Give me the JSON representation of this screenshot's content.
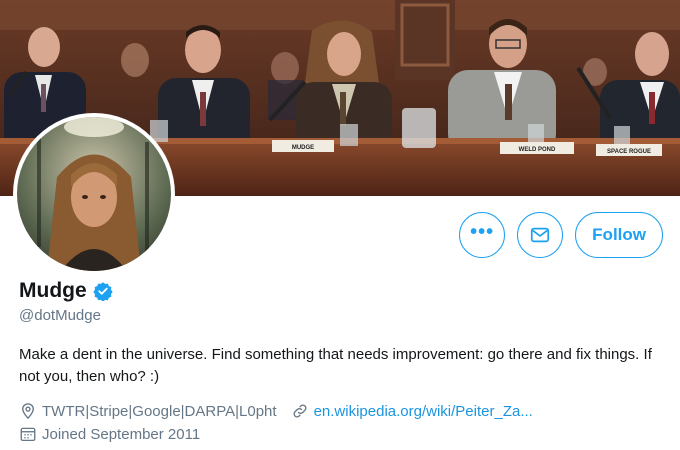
{
  "profile": {
    "display_name": "Mudge",
    "verified_icon": "verified-badge-icon",
    "handle": "@dotMudge",
    "bio": "Make a dent in the universe. Find something that needs improvement: go there and fix things. If not you, then who? :)",
    "location": "TWTR|Stripe|Google|DARPA|L0pht",
    "website": "en.wikipedia.org/wiki/Peiter_Za...",
    "joined": "Joined September 2011"
  },
  "actions": {
    "more_label": "•••",
    "follow_label": "Follow"
  },
  "banner": {
    "nameplates": [
      "MUDGE",
      "WELD POND",
      "SPACE ROGUE"
    ]
  },
  "colors": {
    "accent": "#1da1f2",
    "link": "#1b95e0",
    "secondary_text": "#657786",
    "primary_text": "#14171a"
  },
  "icons": {
    "more": "more-dots-icon",
    "message": "envelope-icon",
    "location": "location-pin-icon",
    "link": "link-icon",
    "calendar": "calendar-icon"
  }
}
